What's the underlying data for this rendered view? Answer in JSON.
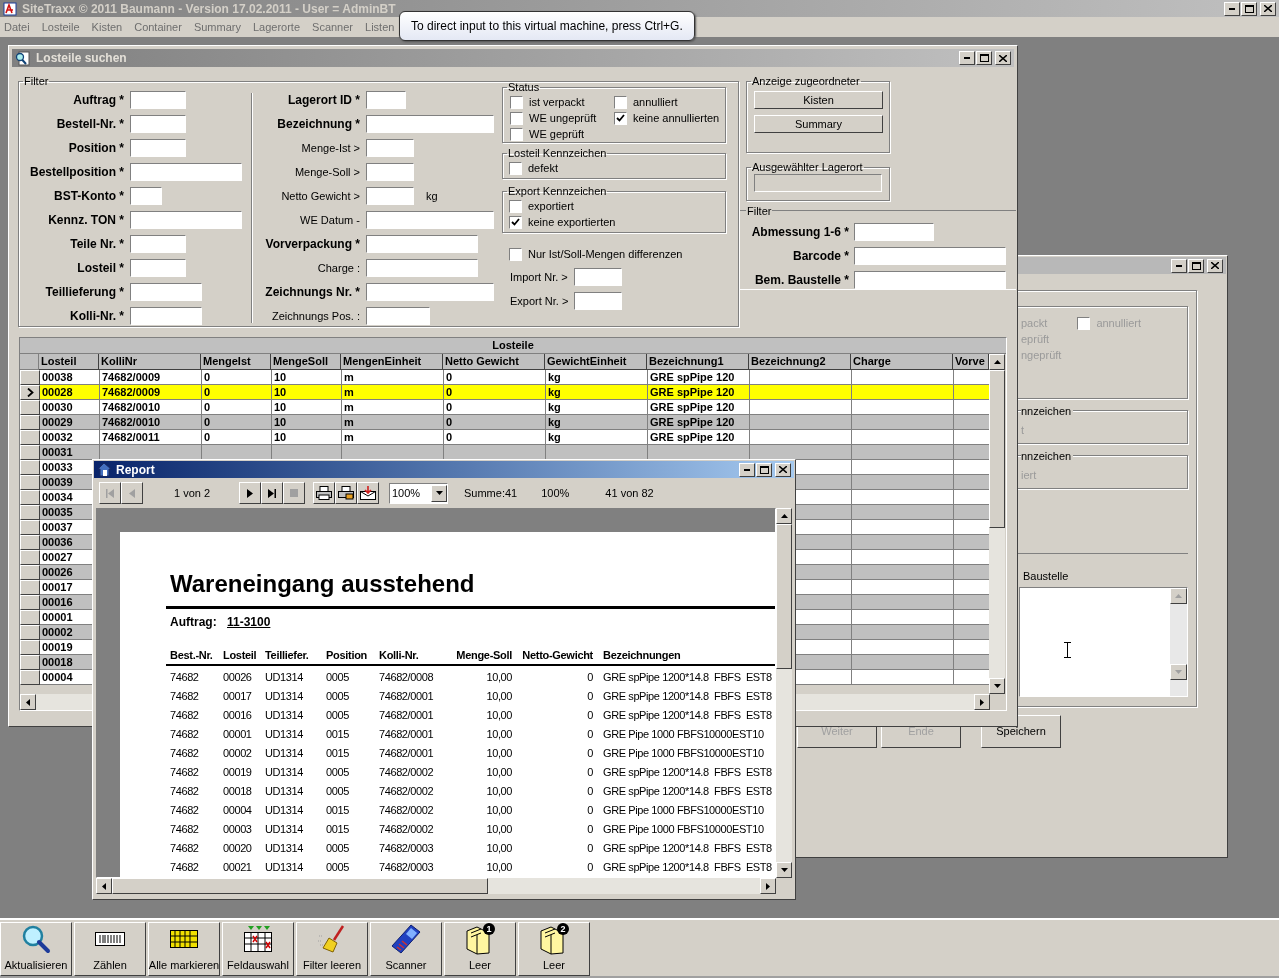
{
  "app": {
    "title": "SiteTraxx © 2011 Baumann - Version 17.02.2011 - User = AdminBT",
    "menu": [
      "Datei",
      "Losteile",
      "Kisten",
      "Container",
      "Summary",
      "Lagerorte",
      "Scanner",
      "Listen"
    ]
  },
  "tooltip": "To direct input to this virtual machine, press Ctrl+G.",
  "back_window": {
    "status_fragments": [
      "packt",
      "eprüft",
      "ngeprüft"
    ],
    "annulliert": {
      "label": "annulliert",
      "checked": false
    },
    "groups": [
      {
        "title": "nnzeichen",
        "item": "t"
      },
      {
        "title": "nnzeichen",
        "item": "iert"
      }
    ],
    "notes_label": "Baustelle",
    "buttons": [
      {
        "label": "Weiter",
        "disabled": true
      },
      {
        "label": "Ende",
        "disabled": true
      },
      {
        "label": "Speichern",
        "disabled": false
      }
    ]
  },
  "search_window": {
    "title": "Losteile suchen",
    "filter_title": "Filter",
    "left_fields": [
      {
        "label": "Auftrag *",
        "emphasis": true
      },
      {
        "label": "Bestell-Nr. *",
        "emphasis": true
      },
      {
        "label": "Position *",
        "emphasis": true
      },
      {
        "label": "Bestellposition *",
        "emphasis": true
      },
      {
        "label": "BST-Konto *",
        "emphasis": true
      },
      {
        "label": "Kennz. TON *",
        "emphasis": true
      },
      {
        "label": "Teile Nr. *",
        "emphasis": true
      },
      {
        "label": "Losteil *",
        "emphasis": true
      },
      {
        "label": "Teillieferung *",
        "emphasis": true
      },
      {
        "label": "Kolli-Nr. *",
        "emphasis": true
      }
    ],
    "middle_fields": [
      {
        "label": "Lagerort ID *",
        "emphasis": true
      },
      {
        "label": "Bezeichnung *",
        "emphasis": true
      },
      {
        "label": "Menge-Ist >",
        "emphasis": false
      },
      {
        "label": "Menge-Soll >",
        "emphasis": false
      },
      {
        "label": "Netto Gewicht >",
        "emphasis": false,
        "unit": "kg"
      },
      {
        "label": "WE Datum -",
        "emphasis": false
      },
      {
        "label": "Vorverpackung *",
        "emphasis": true
      },
      {
        "label": "Charge :",
        "emphasis": false
      },
      {
        "label": "Zeichnungs Nr. *",
        "emphasis": true
      },
      {
        "label": "Zeichnungs Pos. :",
        "emphasis": false
      }
    ],
    "status": {
      "title": "Status",
      "checks": [
        {
          "label": "ist verpackt",
          "checked": false
        },
        {
          "label": "annulliert",
          "checked": false
        },
        {
          "label": "WE ungeprüft",
          "checked": false
        },
        {
          "label": "keine annullierten",
          "checked": true
        },
        {
          "label": "WE geprüft",
          "checked": false
        }
      ]
    },
    "losteil_flags": {
      "title": "Losteil Kennzeichen",
      "checks": [
        {
          "label": "defekt",
          "checked": false
        }
      ]
    },
    "export_flags": {
      "title": "Export Kennzeichen",
      "checks": [
        {
          "label": "exportiert",
          "checked": false
        },
        {
          "label": "keine exportierten",
          "checked": true
        }
      ]
    },
    "only_diff": {
      "label": "Nur Ist/Soll-Mengen differenzen",
      "checked": false
    },
    "range_fields": [
      {
        "label": "Import Nr. >"
      },
      {
        "label": "Export Nr. >"
      }
    ],
    "assigned": {
      "title": "Anzeige zugeordneter",
      "buttons": [
        "Kisten",
        "Summary"
      ]
    },
    "location": {
      "title": "Ausgewählter Lagerort"
    },
    "filter2": {
      "title": "Filter",
      "fields": [
        {
          "label": "Abmessung 1-6 *"
        },
        {
          "label": "Barcode *"
        },
        {
          "label": "Bem. Baustelle *"
        }
      ]
    },
    "table": {
      "caption": "Losteile",
      "columns": [
        "Losteil",
        "KolliNr",
        "MengeIst",
        "MengeSoll",
        "MengenEinheit",
        "Netto Gewicht",
        "GewichtEinheit",
        "Bezeichnung1",
        "Bezeichnung2",
        "Charge",
        "Vorve"
      ],
      "rows": [
        {
          "cells": [
            "00038",
            "74682/0009",
            "0",
            "10",
            "m",
            "0",
            "kg",
            "GRE spPipe 120"
          ],
          "selected": false
        },
        {
          "cells": [
            "00028",
            "74682/0009",
            "0",
            "10",
            "m",
            "0",
            "kg",
            "GRE spPipe 120"
          ],
          "selected": true
        },
        {
          "cells": [
            "00030",
            "74682/0010",
            "0",
            "10",
            "m",
            "0",
            "kg",
            "GRE spPipe 120"
          ],
          "selected": false
        },
        {
          "cells": [
            "00029",
            "74682/0010",
            "0",
            "10",
            "m",
            "0",
            "kg",
            "GRE spPipe 120"
          ],
          "selected": false
        },
        {
          "cells": [
            "00032",
            "74682/0011",
            "0",
            "10",
            "m",
            "0",
            "kg",
            "GRE spPipe 120"
          ],
          "selected": false
        },
        {
          "cells": [
            "00031"
          ],
          "selected": false
        },
        {
          "cells": [
            "00033"
          ],
          "selected": false
        },
        {
          "cells": [
            "00039"
          ],
          "selected": false
        },
        {
          "cells": [
            "00034"
          ],
          "selected": false
        },
        {
          "cells": [
            "00035"
          ],
          "selected": false
        },
        {
          "cells": [
            "00037"
          ],
          "selected": false
        },
        {
          "cells": [
            "00036"
          ],
          "selected": false
        },
        {
          "cells": [
            "00027"
          ],
          "selected": false
        },
        {
          "cells": [
            "00026"
          ],
          "selected": false
        },
        {
          "cells": [
            "00017"
          ],
          "selected": false
        },
        {
          "cells": [
            "00016"
          ],
          "selected": false
        },
        {
          "cells": [
            "00001"
          ],
          "selected": false
        },
        {
          "cells": [
            "00002"
          ],
          "selected": false
        },
        {
          "cells": [
            "00019"
          ],
          "selected": false
        },
        {
          "cells": [
            "00018"
          ],
          "selected": false
        },
        {
          "cells": [
            "00004"
          ],
          "selected": false
        }
      ]
    }
  },
  "report": {
    "title": "Report",
    "page": "1 von 2",
    "zoom": "100%",
    "sum": "Summe:41",
    "percent": "100%",
    "count": "41 von 82",
    "heading": "Wareneingang ausstehend",
    "order_label": "Auftrag:",
    "order_value": "11-3100",
    "columns": [
      "Best.-Nr.",
      "Losteil",
      "Teilliefer.",
      "Position",
      "Kolli-Nr.",
      "Menge-Soll",
      "Netto-Gewicht",
      "Bezeichnungen"
    ],
    "rows": [
      [
        "74682",
        "00026",
        "UD1314",
        "0005",
        "74682/0008",
        "10,00",
        "0",
        "GRE spPipe 1200*14.8  FBFS  EST8"
      ],
      [
        "74682",
        "00017",
        "UD1314",
        "0005",
        "74682/0001",
        "10,00",
        "0",
        "GRE spPipe 1200*14.8  FBFS  EST8"
      ],
      [
        "74682",
        "00016",
        "UD1314",
        "0005",
        "74682/0001",
        "10,00",
        "0",
        "GRE spPipe 1200*14.8  FBFS  EST8"
      ],
      [
        "74682",
        "00001",
        "UD1314",
        "0015",
        "74682/0001",
        "10,00",
        "0",
        "GRE Pipe 1000 FBFS10000EST10"
      ],
      [
        "74682",
        "00002",
        "UD1314",
        "0015",
        "74682/0001",
        "10,00",
        "0",
        "GRE Pipe 1000 FBFS10000EST10"
      ],
      [
        "74682",
        "00019",
        "UD1314",
        "0005",
        "74682/0002",
        "10,00",
        "0",
        "GRE spPipe 1200*14.8  FBFS  EST8"
      ],
      [
        "74682",
        "00018",
        "UD1314",
        "0005",
        "74682/0002",
        "10,00",
        "0",
        "GRE spPipe 1200*14.8  FBFS  EST8"
      ],
      [
        "74682",
        "00004",
        "UD1314",
        "0015",
        "74682/0002",
        "10,00",
        "0",
        "GRE Pipe 1000 FBFS10000EST10"
      ],
      [
        "74682",
        "00003",
        "UD1314",
        "0015",
        "74682/0002",
        "10,00",
        "0",
        "GRE Pipe 1000 FBFS10000EST10"
      ],
      [
        "74682",
        "00020",
        "UD1314",
        "0005",
        "74682/0003",
        "10,00",
        "0",
        "GRE spPipe 1200*14.8  FBFS  EST8"
      ],
      [
        "74682",
        "00021",
        "UD1314",
        "0005",
        "74682/0003",
        "10,00",
        "0",
        "GRE spPipe 1200*14.8  FBFS  EST8"
      ]
    ]
  },
  "toolbar": [
    {
      "label": "Aktualisieren",
      "kind": "search"
    },
    {
      "label": "Zählen",
      "kind": "counter"
    },
    {
      "label": "Alle markieren",
      "kind": "grid"
    },
    {
      "label": "Feldauswahl",
      "kind": "columns"
    },
    {
      "label": "Filter leeren",
      "kind": "broom"
    },
    {
      "label": "Scanner",
      "kind": "scanner"
    },
    {
      "label": "Leer",
      "kind": "folder",
      "badge": "1"
    },
    {
      "label": "Leer",
      "kind": "folder",
      "badge": "2"
    }
  ]
}
